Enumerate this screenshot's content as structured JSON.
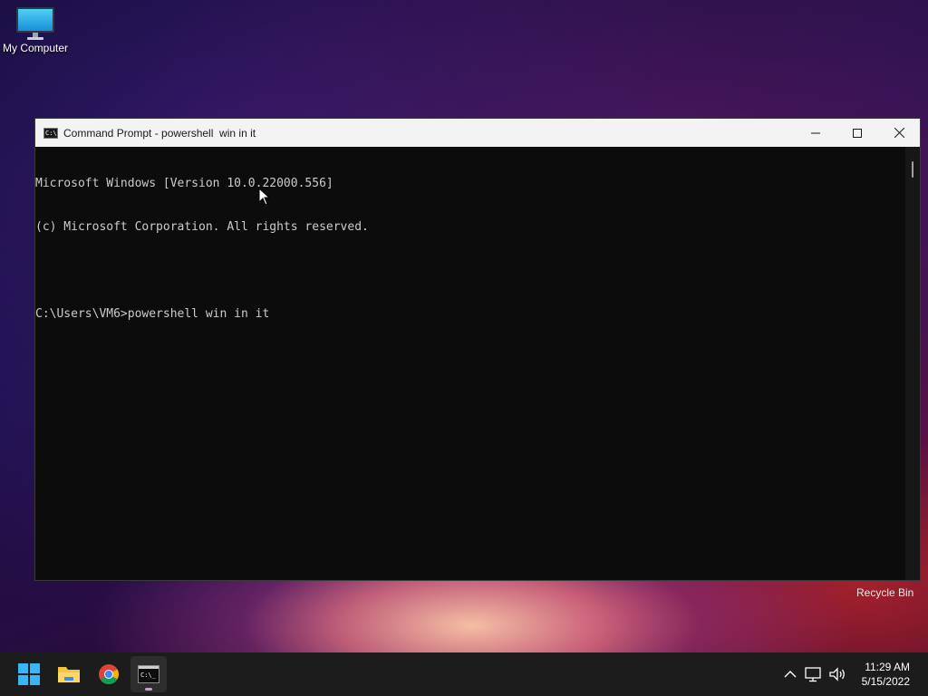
{
  "desktop": {
    "icons": [
      {
        "label": "My Computer",
        "icon": "monitor-icon"
      },
      {
        "label": "Recycle Bin",
        "icon": "recycle-bin-icon"
      }
    ]
  },
  "window": {
    "title": "Command Prompt - powershell  win in it",
    "icon": "command-prompt-icon",
    "buttons": {
      "minimize": "minimize-icon",
      "maximize": "maximize-icon",
      "close": "close-icon"
    },
    "console_lines": [
      "Microsoft Windows [Version 10.0.22000.556]",
      "(c) Microsoft Corporation. All rights reserved.",
      "",
      "C:\\Users\\VM6>powershell win in it"
    ]
  },
  "taskbar": {
    "apps": [
      {
        "name": "start",
        "icon": "windows-logo-icon"
      },
      {
        "name": "file-explorer",
        "icon": "folder-icon"
      },
      {
        "name": "chrome",
        "icon": "chrome-icon"
      },
      {
        "name": "command-prompt",
        "icon": "terminal-icon",
        "active": true
      }
    ],
    "tray": {
      "icons": [
        "chevron-up-icon",
        "network-icon",
        "volume-icon"
      ],
      "time": "11:29 AM",
      "date": "5/15/2022"
    }
  },
  "colors": {
    "console_bg": "#0c0c0c",
    "console_text": "#cccccc",
    "titlebar_bg": "#f3f3f3",
    "taskbar_bg": "#1c1c1c"
  }
}
